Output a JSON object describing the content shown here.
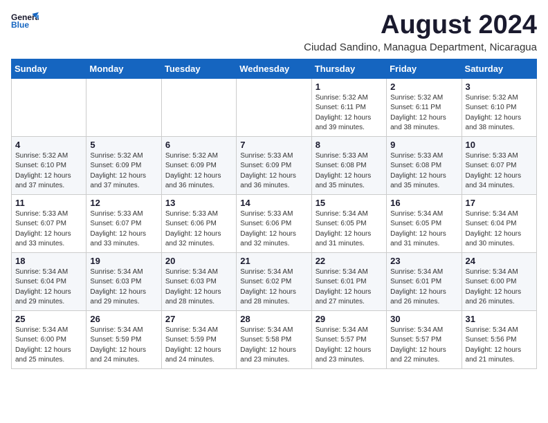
{
  "header": {
    "logo_line1": "General",
    "logo_line2": "Blue",
    "month_year": "August 2024",
    "location": "Ciudad Sandino, Managua Department, Nicaragua"
  },
  "weekdays": [
    "Sunday",
    "Monday",
    "Tuesday",
    "Wednesday",
    "Thursday",
    "Friday",
    "Saturday"
  ],
  "weeks": [
    [
      {
        "day": "",
        "info": ""
      },
      {
        "day": "",
        "info": ""
      },
      {
        "day": "",
        "info": ""
      },
      {
        "day": "",
        "info": ""
      },
      {
        "day": "1",
        "info": "Sunrise: 5:32 AM\nSunset: 6:11 PM\nDaylight: 12 hours\nand 39 minutes."
      },
      {
        "day": "2",
        "info": "Sunrise: 5:32 AM\nSunset: 6:11 PM\nDaylight: 12 hours\nand 38 minutes."
      },
      {
        "day": "3",
        "info": "Sunrise: 5:32 AM\nSunset: 6:10 PM\nDaylight: 12 hours\nand 38 minutes."
      }
    ],
    [
      {
        "day": "4",
        "info": "Sunrise: 5:32 AM\nSunset: 6:10 PM\nDaylight: 12 hours\nand 37 minutes."
      },
      {
        "day": "5",
        "info": "Sunrise: 5:32 AM\nSunset: 6:09 PM\nDaylight: 12 hours\nand 37 minutes."
      },
      {
        "day": "6",
        "info": "Sunrise: 5:32 AM\nSunset: 6:09 PM\nDaylight: 12 hours\nand 36 minutes."
      },
      {
        "day": "7",
        "info": "Sunrise: 5:33 AM\nSunset: 6:09 PM\nDaylight: 12 hours\nand 36 minutes."
      },
      {
        "day": "8",
        "info": "Sunrise: 5:33 AM\nSunset: 6:08 PM\nDaylight: 12 hours\nand 35 minutes."
      },
      {
        "day": "9",
        "info": "Sunrise: 5:33 AM\nSunset: 6:08 PM\nDaylight: 12 hours\nand 35 minutes."
      },
      {
        "day": "10",
        "info": "Sunrise: 5:33 AM\nSunset: 6:07 PM\nDaylight: 12 hours\nand 34 minutes."
      }
    ],
    [
      {
        "day": "11",
        "info": "Sunrise: 5:33 AM\nSunset: 6:07 PM\nDaylight: 12 hours\nand 33 minutes."
      },
      {
        "day": "12",
        "info": "Sunrise: 5:33 AM\nSunset: 6:07 PM\nDaylight: 12 hours\nand 33 minutes."
      },
      {
        "day": "13",
        "info": "Sunrise: 5:33 AM\nSunset: 6:06 PM\nDaylight: 12 hours\nand 32 minutes."
      },
      {
        "day": "14",
        "info": "Sunrise: 5:33 AM\nSunset: 6:06 PM\nDaylight: 12 hours\nand 32 minutes."
      },
      {
        "day": "15",
        "info": "Sunrise: 5:34 AM\nSunset: 6:05 PM\nDaylight: 12 hours\nand 31 minutes."
      },
      {
        "day": "16",
        "info": "Sunrise: 5:34 AM\nSunset: 6:05 PM\nDaylight: 12 hours\nand 31 minutes."
      },
      {
        "day": "17",
        "info": "Sunrise: 5:34 AM\nSunset: 6:04 PM\nDaylight: 12 hours\nand 30 minutes."
      }
    ],
    [
      {
        "day": "18",
        "info": "Sunrise: 5:34 AM\nSunset: 6:04 PM\nDaylight: 12 hours\nand 29 minutes."
      },
      {
        "day": "19",
        "info": "Sunrise: 5:34 AM\nSunset: 6:03 PM\nDaylight: 12 hours\nand 29 minutes."
      },
      {
        "day": "20",
        "info": "Sunrise: 5:34 AM\nSunset: 6:03 PM\nDaylight: 12 hours\nand 28 minutes."
      },
      {
        "day": "21",
        "info": "Sunrise: 5:34 AM\nSunset: 6:02 PM\nDaylight: 12 hours\nand 28 minutes."
      },
      {
        "day": "22",
        "info": "Sunrise: 5:34 AM\nSunset: 6:01 PM\nDaylight: 12 hours\nand 27 minutes."
      },
      {
        "day": "23",
        "info": "Sunrise: 5:34 AM\nSunset: 6:01 PM\nDaylight: 12 hours\nand 26 minutes."
      },
      {
        "day": "24",
        "info": "Sunrise: 5:34 AM\nSunset: 6:00 PM\nDaylight: 12 hours\nand 26 minutes."
      }
    ],
    [
      {
        "day": "25",
        "info": "Sunrise: 5:34 AM\nSunset: 6:00 PM\nDaylight: 12 hours\nand 25 minutes."
      },
      {
        "day": "26",
        "info": "Sunrise: 5:34 AM\nSunset: 5:59 PM\nDaylight: 12 hours\nand 24 minutes."
      },
      {
        "day": "27",
        "info": "Sunrise: 5:34 AM\nSunset: 5:59 PM\nDaylight: 12 hours\nand 24 minutes."
      },
      {
        "day": "28",
        "info": "Sunrise: 5:34 AM\nSunset: 5:58 PM\nDaylight: 12 hours\nand 23 minutes."
      },
      {
        "day": "29",
        "info": "Sunrise: 5:34 AM\nSunset: 5:57 PM\nDaylight: 12 hours\nand 23 minutes."
      },
      {
        "day": "30",
        "info": "Sunrise: 5:34 AM\nSunset: 5:57 PM\nDaylight: 12 hours\nand 22 minutes."
      },
      {
        "day": "31",
        "info": "Sunrise: 5:34 AM\nSunset: 5:56 PM\nDaylight: 12 hours\nand 21 minutes."
      }
    ]
  ]
}
